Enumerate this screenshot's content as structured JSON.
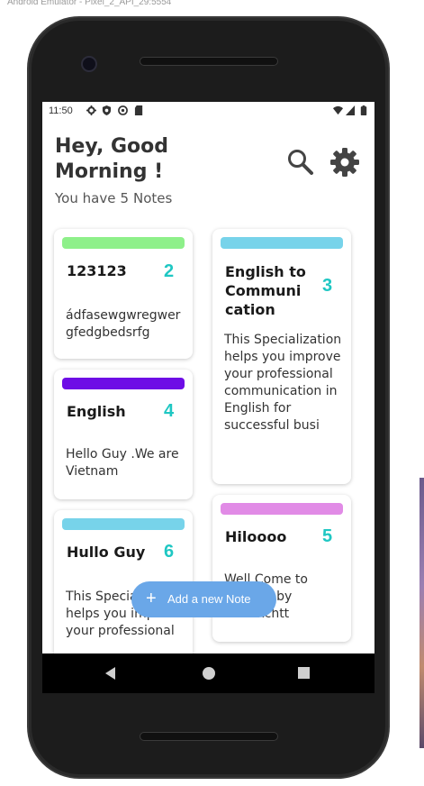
{
  "window_title": "Android Emulator - Pixel_2_API_29:5554",
  "status_bar": {
    "time": "11:50",
    "icons": [
      "gear-icon",
      "shield-icon",
      "sync-icon",
      "sim-card-icon",
      "wifi-icon",
      "signal-icon",
      "battery-icon"
    ]
  },
  "header": {
    "greeting": "Hey, Good Morning !",
    "notes_prefix": "You have",
    "notes_count": "5",
    "notes_suffix": "Notes"
  },
  "notes": [
    {
      "title": "123123",
      "number": "2",
      "body": "ádfasewgwregwer gfedgbedsrfg",
      "color": "#8ef08a"
    },
    {
      "title": "English",
      "number": "4",
      "body": "Hello Guy .We are Vietnam",
      "color": "#6e0de6"
    },
    {
      "title": "Hullo Guy",
      "number": "6",
      "body": "This Specialization helps you improve your professional",
      "color": "#77d3ea"
    },
    {
      "title": "English to Communi cation",
      "number": "3",
      "body": "This Specialization helps you improve your professional communication in English for successful busi",
      "color": "#77d3ea"
    },
    {
      "title": "Hiloooo",
      "number": "5",
      "body": "Well Come to my App by Namixchtt",
      "color": "#e18be6"
    }
  ],
  "fab": {
    "label": "Add a new Note",
    "color": "#6aa7e8"
  },
  "accent_number_color": "#1fc7c3"
}
